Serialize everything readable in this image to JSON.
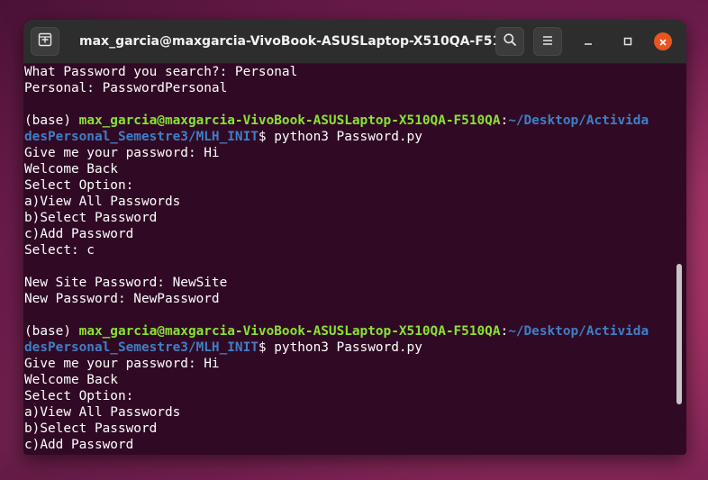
{
  "window": {
    "title": "max_garcia@maxgarcia-VivoBook-ASUSLaptop-X510QA-F510...",
    "new_tab_icon": "new-tab-icon",
    "search_icon": "search-icon",
    "menu_icon": "hamburger-menu-icon",
    "close_color": "#e95420"
  },
  "terminal": {
    "background": "#300a24",
    "lines": [
      {
        "type": "text",
        "text": "What Password you search?: Personal"
      },
      {
        "type": "text",
        "text": "Personal: PasswordPersonal"
      },
      {
        "type": "text",
        "text": ""
      },
      {
        "type": "prompt",
        "env": "(base) ",
        "user": "max_garcia@maxgarcia-VivoBook-ASUSLaptop-X510QA-F510QA",
        "colon": ":",
        "path": "~/Desktop/Activida"
      },
      {
        "type": "prompt2",
        "path": "desPersonal_Semestre3/MLH_INIT",
        "cmd": "$ python3 Password.py"
      },
      {
        "type": "text",
        "text": "Give me your password: Hi"
      },
      {
        "type": "text",
        "text": "Welcome Back"
      },
      {
        "type": "text",
        "text": "Select Option:"
      },
      {
        "type": "text",
        "text": "a)View All Passwords"
      },
      {
        "type": "text",
        "text": "b)Select Password"
      },
      {
        "type": "text",
        "text": "c)Add Password"
      },
      {
        "type": "text",
        "text": "Select: c"
      },
      {
        "type": "text",
        "text": ""
      },
      {
        "type": "text",
        "text": "New Site Password: NewSite"
      },
      {
        "type": "text",
        "text": "New Password: NewPassword"
      },
      {
        "type": "text",
        "text": ""
      },
      {
        "type": "prompt",
        "env": "(base) ",
        "user": "max_garcia@maxgarcia-VivoBook-ASUSLaptop-X510QA-F510QA",
        "colon": ":",
        "path": "~/Desktop/Activida"
      },
      {
        "type": "prompt2",
        "path": "desPersonal_Semestre3/MLH_INIT",
        "cmd": "$ python3 Password.py"
      },
      {
        "type": "text",
        "text": "Give me your password: Hi"
      },
      {
        "type": "text",
        "text": "Welcome Back"
      },
      {
        "type": "text",
        "text": "Select Option:"
      },
      {
        "type": "text",
        "text": "a)View All Passwords"
      },
      {
        "type": "text",
        "text": "b)Select Password"
      },
      {
        "type": "text",
        "text": "c)Add Password"
      }
    ]
  }
}
